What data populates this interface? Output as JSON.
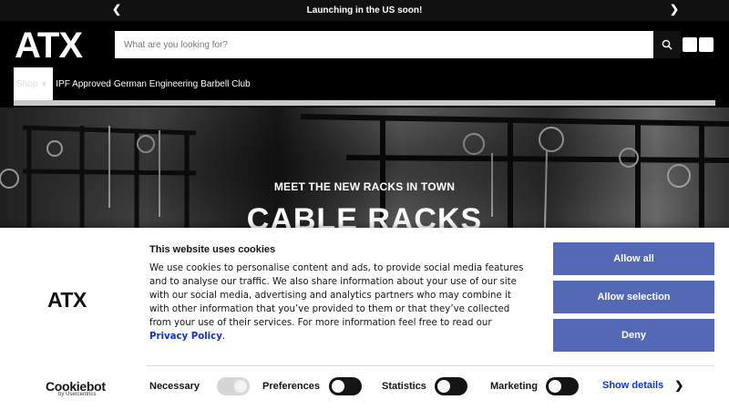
{
  "announcement": {
    "text": "Launching in the US soon!",
    "prev_icon": "chevron-left-icon",
    "next_icon": "chevron-right-icon"
  },
  "header": {
    "logo_text": "ATX",
    "search": {
      "placeholder": "What are you looking for?",
      "value": ""
    },
    "icons": [
      "search-icon",
      "wishlist-icon",
      "cart-icon"
    ]
  },
  "nav": {
    "shop_label": "Shop",
    "items": [
      "IPF Approved",
      "German Engineering",
      "Barbell Club"
    ]
  },
  "hero": {
    "subtitle": "MEET THE NEW RACKS IN TOWN",
    "title": "CABLE RACKS"
  },
  "cookie": {
    "logo_text": "ATX",
    "title": "This website uses cookies",
    "body": "We use cookies to personalise content and ads, to provide social media features and to analyse our traffic. We also share information about your use of our site with our social media, advertising and analytics partners who may combine it with other information that you’ve provided to them or that they’ve collected from your use of their services. For more information feel free to read our ",
    "policy_link": "Privacy Policy",
    "body_end": ".",
    "buttons": {
      "allow_all": "Allow all",
      "allow_selection": "Allow selection",
      "deny": "Deny"
    },
    "brand": {
      "main": "Cookiebot",
      "sub": "by Usercentrics"
    },
    "toggles": {
      "necessary": "Necessary",
      "preferences": "Preferences",
      "statistics": "Statistics",
      "marketing": "Marketing"
    },
    "show_details": "Show details",
    "colors": {
      "button": "#5469b5",
      "link": "#1032cf",
      "toggle_on": "#141414"
    }
  }
}
